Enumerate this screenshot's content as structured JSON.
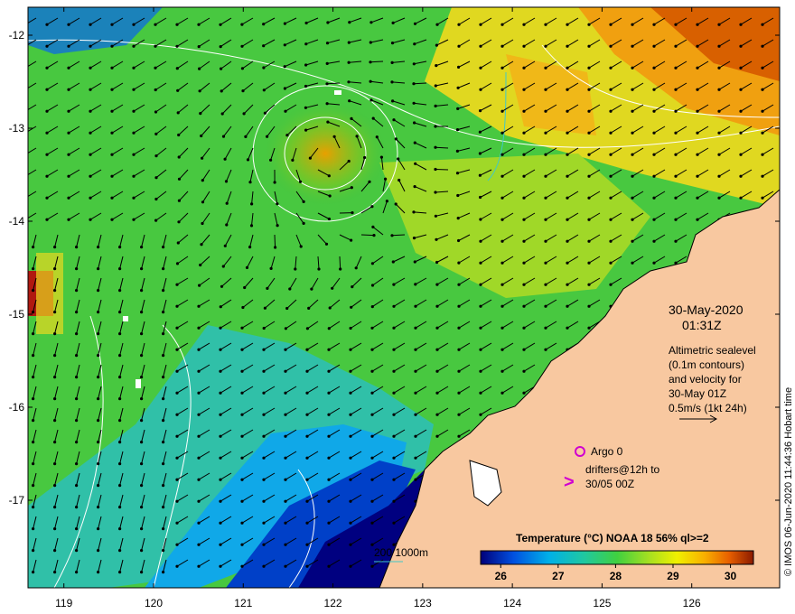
{
  "map": {
    "x_ticks": [
      "119",
      "120",
      "121",
      "122",
      "123",
      "124",
      "125",
      "126"
    ],
    "x_values": [
      119,
      120,
      121,
      122,
      123,
      124,
      125,
      126
    ],
    "y_ticks": [
      "-12",
      "-13",
      "-14",
      "-15",
      "-16",
      "-17"
    ],
    "y_values": [
      -12,
      -13,
      -14,
      -15,
      -16,
      -17
    ],
    "lon_range": [
      118.6,
      126.98
    ],
    "lat_range": [
      -12.0,
      -18.0
    ]
  },
  "annotation": {
    "date": "30-May-2020",
    "time": "01:31Z",
    "altimetry_lines": [
      "Altimetric sealevel",
      "(0.1m contours)",
      "and velocity for",
      "30-May 01Z",
      "0.5m/s (1kt 24h)"
    ],
    "argo_label": "Argo 0",
    "drifters_line1": "drifters@12h to",
    "drifters_line2": "30/05 00Z",
    "drifter_marker": ">",
    "depth_legend": "200  1000m"
  },
  "colorbar": {
    "title": "Temperature (°C) NOAA 18 56% ql>=2",
    "ticks": [
      "26",
      "27",
      "28",
      "29",
      "30"
    ],
    "values": [
      26,
      27,
      28,
      29,
      30
    ],
    "range": [
      25.65,
      30.4
    ]
  },
  "credit": "© IMOS 06-Jun-2020 11:44:36 Hobart time",
  "colors": {
    "land": "#f8c8a0",
    "deep_blue": "#000080",
    "contour_white": "#ffffff",
    "argo_magenta": "#d000d0",
    "depth_cyan": "#40c8c8"
  }
}
